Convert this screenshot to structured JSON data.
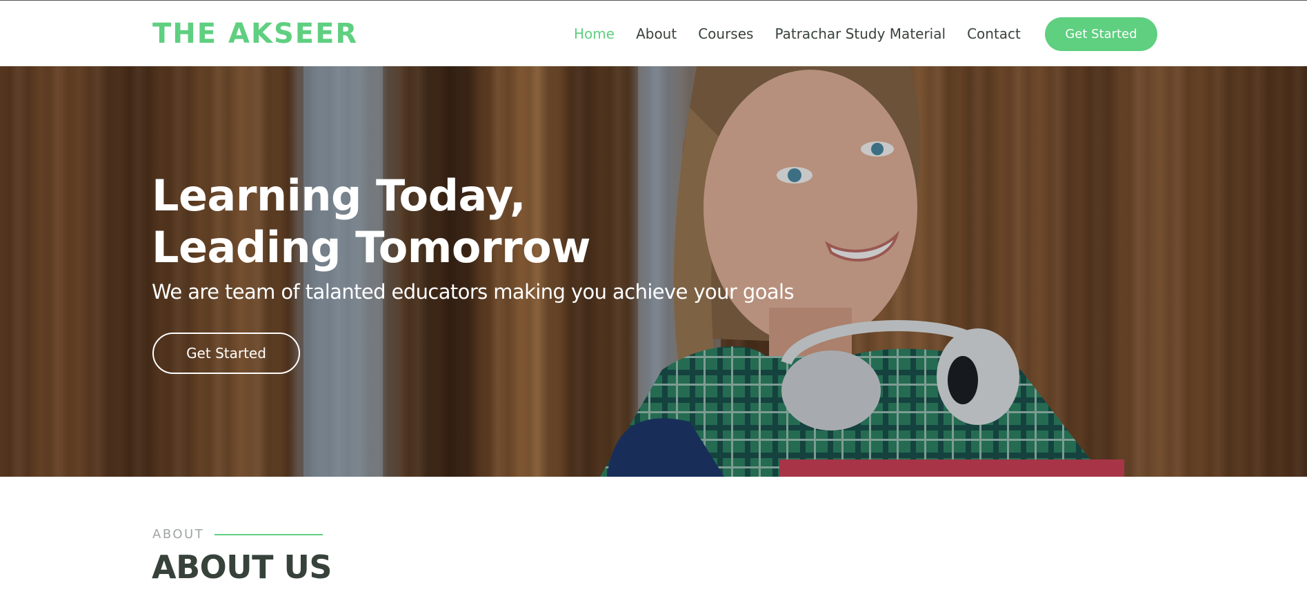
{
  "header": {
    "logo": "THE AKSEER",
    "nav": [
      {
        "label": "Home",
        "active": true
      },
      {
        "label": "About",
        "active": false
      },
      {
        "label": "Courses",
        "active": false
      },
      {
        "label": "Patrachar Study Material",
        "active": false
      },
      {
        "label": "Contact",
        "active": false
      }
    ],
    "cta_label": "Get Started"
  },
  "hero": {
    "title_line1": "Learning Today,",
    "title_line2": "Leading Tomorrow",
    "subtitle": "We are team of talanted educators making you achieve your goals",
    "button_label": "Get Started"
  },
  "about": {
    "eyebrow": "ABOUT",
    "title": "ABOUT US"
  },
  "colors": {
    "accent": "#5fcf80",
    "text_dark": "#37423b",
    "muted": "#a0a5a2",
    "white": "#ffffff"
  }
}
